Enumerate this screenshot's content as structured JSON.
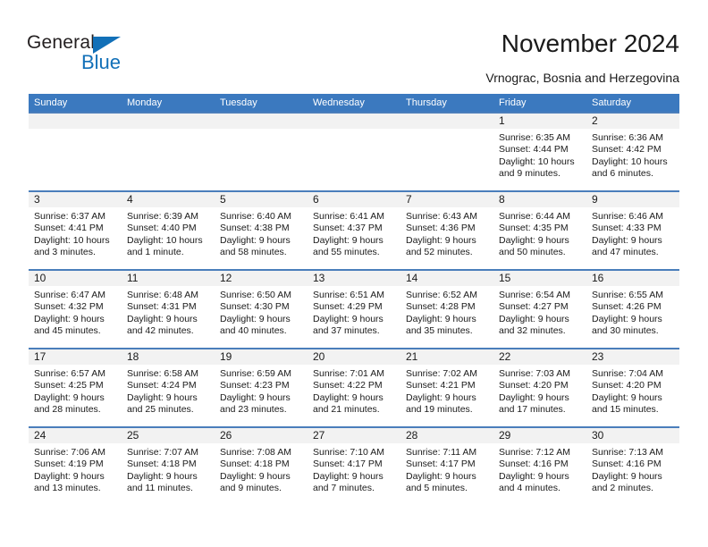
{
  "logo": {
    "word_one": "General",
    "word_two": "Blue",
    "triangle_icon": "blue-triangle-icon",
    "accent_color": "#1270b8"
  },
  "header": {
    "title": "November 2024",
    "subtitle": "Vrnograc, Bosnia and Herzegovina"
  },
  "theme": {
    "header_row_bg": "#3b79bf",
    "week_divider": "#4a7ebb",
    "day_band_bg": "#f2f2f2",
    "text_color": "#1a1a1a"
  },
  "weekdays": [
    "Sunday",
    "Monday",
    "Tuesday",
    "Wednesday",
    "Thursday",
    "Friday",
    "Saturday"
  ],
  "weeks": [
    [
      {
        "day": "",
        "sunrise": "",
        "sunset": "",
        "daylight": ""
      },
      {
        "day": "",
        "sunrise": "",
        "sunset": "",
        "daylight": ""
      },
      {
        "day": "",
        "sunrise": "",
        "sunset": "",
        "daylight": ""
      },
      {
        "day": "",
        "sunrise": "",
        "sunset": "",
        "daylight": ""
      },
      {
        "day": "",
        "sunrise": "",
        "sunset": "",
        "daylight": ""
      },
      {
        "day": "1",
        "sunrise": "Sunrise: 6:35 AM",
        "sunset": "Sunset: 4:44 PM",
        "daylight": "Daylight: 10 hours and 9 minutes."
      },
      {
        "day": "2",
        "sunrise": "Sunrise: 6:36 AM",
        "sunset": "Sunset: 4:42 PM",
        "daylight": "Daylight: 10 hours and 6 minutes."
      }
    ],
    [
      {
        "day": "3",
        "sunrise": "Sunrise: 6:37 AM",
        "sunset": "Sunset: 4:41 PM",
        "daylight": "Daylight: 10 hours and 3 minutes."
      },
      {
        "day": "4",
        "sunrise": "Sunrise: 6:39 AM",
        "sunset": "Sunset: 4:40 PM",
        "daylight": "Daylight: 10 hours and 1 minute."
      },
      {
        "day": "5",
        "sunrise": "Sunrise: 6:40 AM",
        "sunset": "Sunset: 4:38 PM",
        "daylight": "Daylight: 9 hours and 58 minutes."
      },
      {
        "day": "6",
        "sunrise": "Sunrise: 6:41 AM",
        "sunset": "Sunset: 4:37 PM",
        "daylight": "Daylight: 9 hours and 55 minutes."
      },
      {
        "day": "7",
        "sunrise": "Sunrise: 6:43 AM",
        "sunset": "Sunset: 4:36 PM",
        "daylight": "Daylight: 9 hours and 52 minutes."
      },
      {
        "day": "8",
        "sunrise": "Sunrise: 6:44 AM",
        "sunset": "Sunset: 4:35 PM",
        "daylight": "Daylight: 9 hours and 50 minutes."
      },
      {
        "day": "9",
        "sunrise": "Sunrise: 6:46 AM",
        "sunset": "Sunset: 4:33 PM",
        "daylight": "Daylight: 9 hours and 47 minutes."
      }
    ],
    [
      {
        "day": "10",
        "sunrise": "Sunrise: 6:47 AM",
        "sunset": "Sunset: 4:32 PM",
        "daylight": "Daylight: 9 hours and 45 minutes."
      },
      {
        "day": "11",
        "sunrise": "Sunrise: 6:48 AM",
        "sunset": "Sunset: 4:31 PM",
        "daylight": "Daylight: 9 hours and 42 minutes."
      },
      {
        "day": "12",
        "sunrise": "Sunrise: 6:50 AM",
        "sunset": "Sunset: 4:30 PM",
        "daylight": "Daylight: 9 hours and 40 minutes."
      },
      {
        "day": "13",
        "sunrise": "Sunrise: 6:51 AM",
        "sunset": "Sunset: 4:29 PM",
        "daylight": "Daylight: 9 hours and 37 minutes."
      },
      {
        "day": "14",
        "sunrise": "Sunrise: 6:52 AM",
        "sunset": "Sunset: 4:28 PM",
        "daylight": "Daylight: 9 hours and 35 minutes."
      },
      {
        "day": "15",
        "sunrise": "Sunrise: 6:54 AM",
        "sunset": "Sunset: 4:27 PM",
        "daylight": "Daylight: 9 hours and 32 minutes."
      },
      {
        "day": "16",
        "sunrise": "Sunrise: 6:55 AM",
        "sunset": "Sunset: 4:26 PM",
        "daylight": "Daylight: 9 hours and 30 minutes."
      }
    ],
    [
      {
        "day": "17",
        "sunrise": "Sunrise: 6:57 AM",
        "sunset": "Sunset: 4:25 PM",
        "daylight": "Daylight: 9 hours and 28 minutes."
      },
      {
        "day": "18",
        "sunrise": "Sunrise: 6:58 AM",
        "sunset": "Sunset: 4:24 PM",
        "daylight": "Daylight: 9 hours and 25 minutes."
      },
      {
        "day": "19",
        "sunrise": "Sunrise: 6:59 AM",
        "sunset": "Sunset: 4:23 PM",
        "daylight": "Daylight: 9 hours and 23 minutes."
      },
      {
        "day": "20",
        "sunrise": "Sunrise: 7:01 AM",
        "sunset": "Sunset: 4:22 PM",
        "daylight": "Daylight: 9 hours and 21 minutes."
      },
      {
        "day": "21",
        "sunrise": "Sunrise: 7:02 AM",
        "sunset": "Sunset: 4:21 PM",
        "daylight": "Daylight: 9 hours and 19 minutes."
      },
      {
        "day": "22",
        "sunrise": "Sunrise: 7:03 AM",
        "sunset": "Sunset: 4:20 PM",
        "daylight": "Daylight: 9 hours and 17 minutes."
      },
      {
        "day": "23",
        "sunrise": "Sunrise: 7:04 AM",
        "sunset": "Sunset: 4:20 PM",
        "daylight": "Daylight: 9 hours and 15 minutes."
      }
    ],
    [
      {
        "day": "24",
        "sunrise": "Sunrise: 7:06 AM",
        "sunset": "Sunset: 4:19 PM",
        "daylight": "Daylight: 9 hours and 13 minutes."
      },
      {
        "day": "25",
        "sunrise": "Sunrise: 7:07 AM",
        "sunset": "Sunset: 4:18 PM",
        "daylight": "Daylight: 9 hours and 11 minutes."
      },
      {
        "day": "26",
        "sunrise": "Sunrise: 7:08 AM",
        "sunset": "Sunset: 4:18 PM",
        "daylight": "Daylight: 9 hours and 9 minutes."
      },
      {
        "day": "27",
        "sunrise": "Sunrise: 7:10 AM",
        "sunset": "Sunset: 4:17 PM",
        "daylight": "Daylight: 9 hours and 7 minutes."
      },
      {
        "day": "28",
        "sunrise": "Sunrise: 7:11 AM",
        "sunset": "Sunset: 4:17 PM",
        "daylight": "Daylight: 9 hours and 5 minutes."
      },
      {
        "day": "29",
        "sunrise": "Sunrise: 7:12 AM",
        "sunset": "Sunset: 4:16 PM",
        "daylight": "Daylight: 9 hours and 4 minutes."
      },
      {
        "day": "30",
        "sunrise": "Sunrise: 7:13 AM",
        "sunset": "Sunset: 4:16 PM",
        "daylight": "Daylight: 9 hours and 2 minutes."
      }
    ]
  ]
}
